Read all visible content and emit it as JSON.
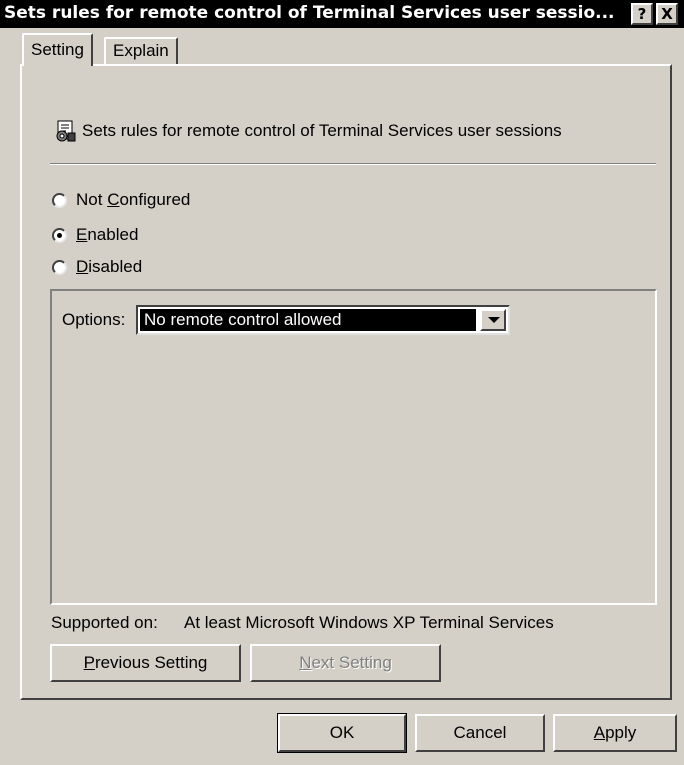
{
  "window": {
    "title": "Sets rules for remote control of Terminal Services user sessio...",
    "help_glyph": "?",
    "close_glyph": "X"
  },
  "tabs": [
    {
      "label": "Setting",
      "active": true
    },
    {
      "label": "Explain",
      "active": false
    }
  ],
  "policy": {
    "icon": "policy-settings-icon",
    "title": "Sets rules for remote control of Terminal Services user sessions"
  },
  "state": {
    "options": [
      {
        "pre": "Not ",
        "key": "C",
        "post": "onfigured",
        "checked": false
      },
      {
        "pre": "",
        "key": "E",
        "post": "nabled",
        "checked": true
      },
      {
        "pre": "",
        "key": "D",
        "post": "isabled",
        "checked": false
      }
    ]
  },
  "options": {
    "label": "Options:",
    "selected": "No remote control allowed"
  },
  "supported": {
    "label": "Supported on:",
    "value": "At least Microsoft Windows XP Terminal Services"
  },
  "nav_buttons": {
    "previous": {
      "key": "P",
      "rest": "revious Setting",
      "enabled": true
    },
    "next": {
      "key": "N",
      "rest": "ext Setting",
      "enabled": false
    }
  },
  "dialog_buttons": {
    "ok": "OK",
    "cancel": "Cancel",
    "apply_key": "A",
    "apply_rest": "pply"
  }
}
